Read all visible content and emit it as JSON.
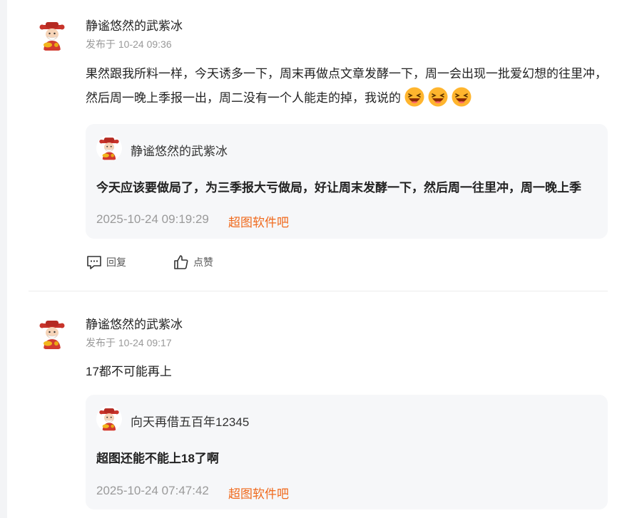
{
  "comments": [
    {
      "author": "静谧悠然的武紫冰",
      "time": "发布于 10-24 09:36",
      "content": "果然跟我所料一样，今天诱多一下，周末再做点文章发酵一下，周一会出现一批爱幻想的往里冲，然后周一晚上季报一出，周二没有一个人能走的掉，我说的",
      "emojis": [
        "laughing-emoji",
        "laughing-emoji",
        "laughing-emoji"
      ],
      "quote": {
        "author": "静谧悠然的武紫冰",
        "text": "今天应该要做局了，为三季报大亏做局，好让周末发酵一下，然后周一往里冲，周一晚上季",
        "time": "2025-10-24 09:19:29",
        "source": "超图软件吧"
      },
      "actions": {
        "reply": "回复",
        "like": "点赞"
      }
    },
    {
      "author": "静谧悠然的武紫冰",
      "time": "发布于 10-24 09:17",
      "content": "17都不可能再上",
      "quote": {
        "author": "向天再借五百年12345",
        "text": "超图还能不能上18了啊",
        "time": "2025-10-24 07:47:42",
        "source": "超图软件吧"
      }
    }
  ],
  "colors": {
    "source_link": "#f06a1d",
    "quote_bg": "#f6f7f9",
    "muted": "#999999"
  },
  "icons": {
    "avatar": "god-of-wealth-avatar",
    "reply": "comment-icon",
    "like": "thumbs-up-icon"
  }
}
